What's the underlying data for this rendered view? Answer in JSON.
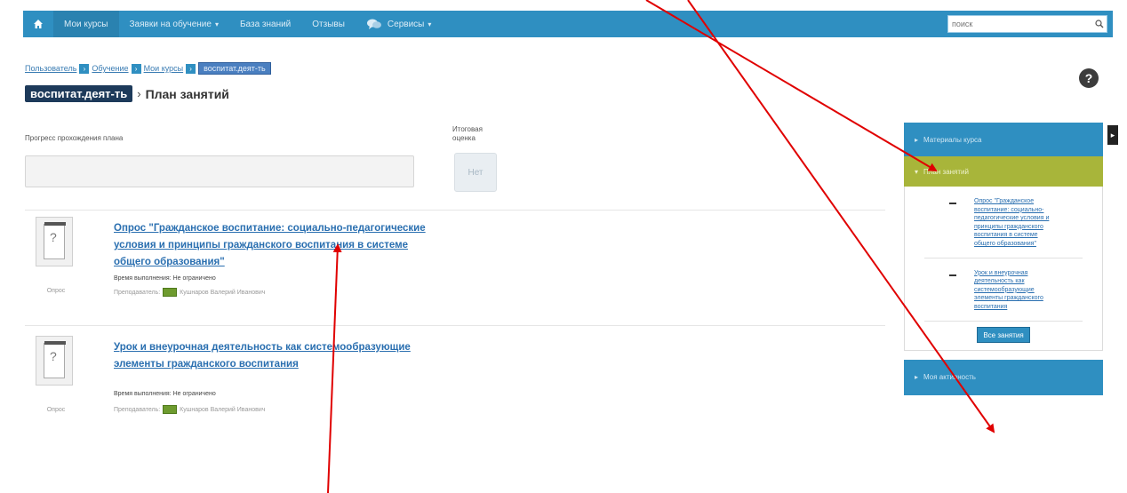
{
  "nav": {
    "items": [
      {
        "label": "Мои курсы",
        "active": true
      },
      {
        "label": "Заявки на обучение",
        "caret": "▾"
      },
      {
        "label": "База знаний"
      },
      {
        "label": "Отзывы"
      },
      {
        "label": "Сервисы",
        "caret": "▾"
      }
    ],
    "search_placeholder": "поиск"
  },
  "breadcrumb": {
    "items": [
      "Пользователь",
      "Обучение",
      "Мои курсы"
    ],
    "current": "воспитат.деят-ть"
  },
  "help_label": "?",
  "title": {
    "course": "воспитат.деят-ть",
    "separator": "›",
    "page": "План занятий"
  },
  "progress": {
    "label": "Прогресс прохождения плана",
    "final_label": "Итоговая оценка",
    "final_value": "Нет"
  },
  "lessons": [
    {
      "title": "Опрос \"Гражданское воспитание: социально-педагогические условия и принципы гражданского воспитания в системе общего образования\"",
      "time": "Время выполнения: Не ограничено",
      "teacher_label": "Преподаватель:",
      "teacher": "Кушнаров Валерий Иванович",
      "type": "Опрос"
    },
    {
      "title": "Урок и внеурочная деятельность как системообразующие элементы гражданского воспитания",
      "time": "Время выполнения: Не ограничено",
      "teacher_label": "Преподаватель:",
      "teacher": "Кушнаров Валерий Иванович",
      "type": "Опрос"
    }
  ],
  "sidebar": {
    "materials": "Материалы курса",
    "plan": "План занятий",
    "items": [
      "Опрос \"Гражданское воспитание: социально-педагогические условия и принципы гражданского воспитания в системе общего образования\"",
      "Урок и внеурочная деятельность как системообразующие элементы гражданского воспитания"
    ],
    "all_lessons": "Все занятия",
    "activity": "Моя активность",
    "toggle": "▸"
  },
  "colors": {
    "nav": "#2f8fc1",
    "plan_active": "#a8b53a",
    "link": "#2a6fb0",
    "arrow": "#e00000"
  }
}
